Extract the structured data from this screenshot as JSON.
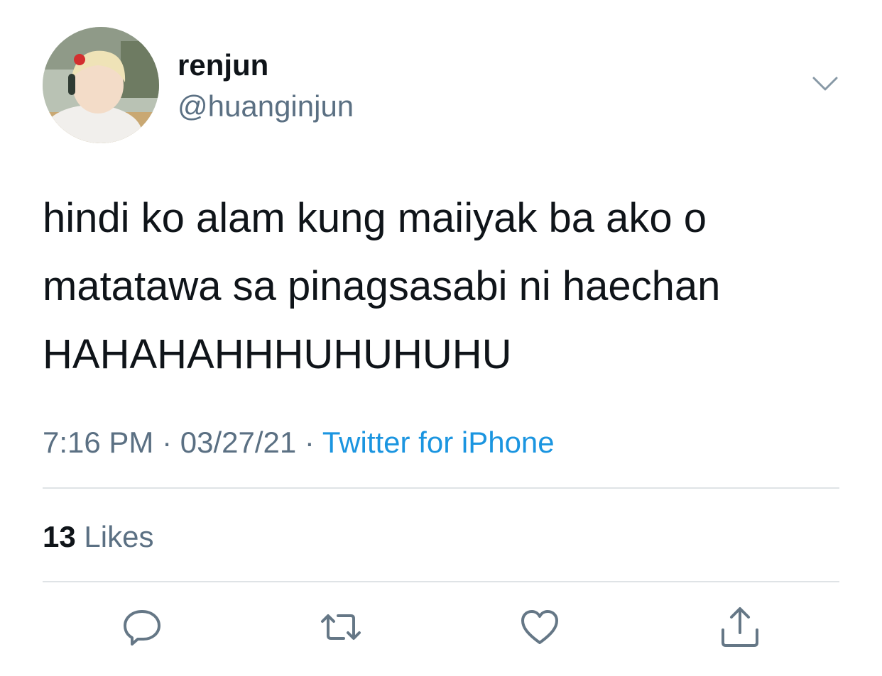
{
  "user": {
    "display_name": "renjun",
    "handle": "@huanginjun",
    "avatar_icon": "profile-photo"
  },
  "tweet": {
    "lines": [
      "hindi ko alam kung maiiyak ba ako o",
      "matatawa sa pinagsasabi ni haechan",
      "HAHAHAHHHUHUHUHU"
    ]
  },
  "meta": {
    "time": "7:16 PM",
    "separator": " · ",
    "date": "03/27/21",
    "source": "Twitter for iPhone"
  },
  "engagement": {
    "likes_count": "13",
    "likes_label": "Likes"
  },
  "actions": [
    {
      "name": "reply",
      "icon": "speech-bubble-icon"
    },
    {
      "name": "retweet",
      "icon": "retweet-icon"
    },
    {
      "name": "like",
      "icon": "heart-icon"
    },
    {
      "name": "share",
      "icon": "share-icon"
    }
  ],
  "colors": {
    "text_primary": "#0f1419",
    "text_secondary": "#5b7083",
    "link": "#1b95e0",
    "divider": "#dfe3e6"
  }
}
